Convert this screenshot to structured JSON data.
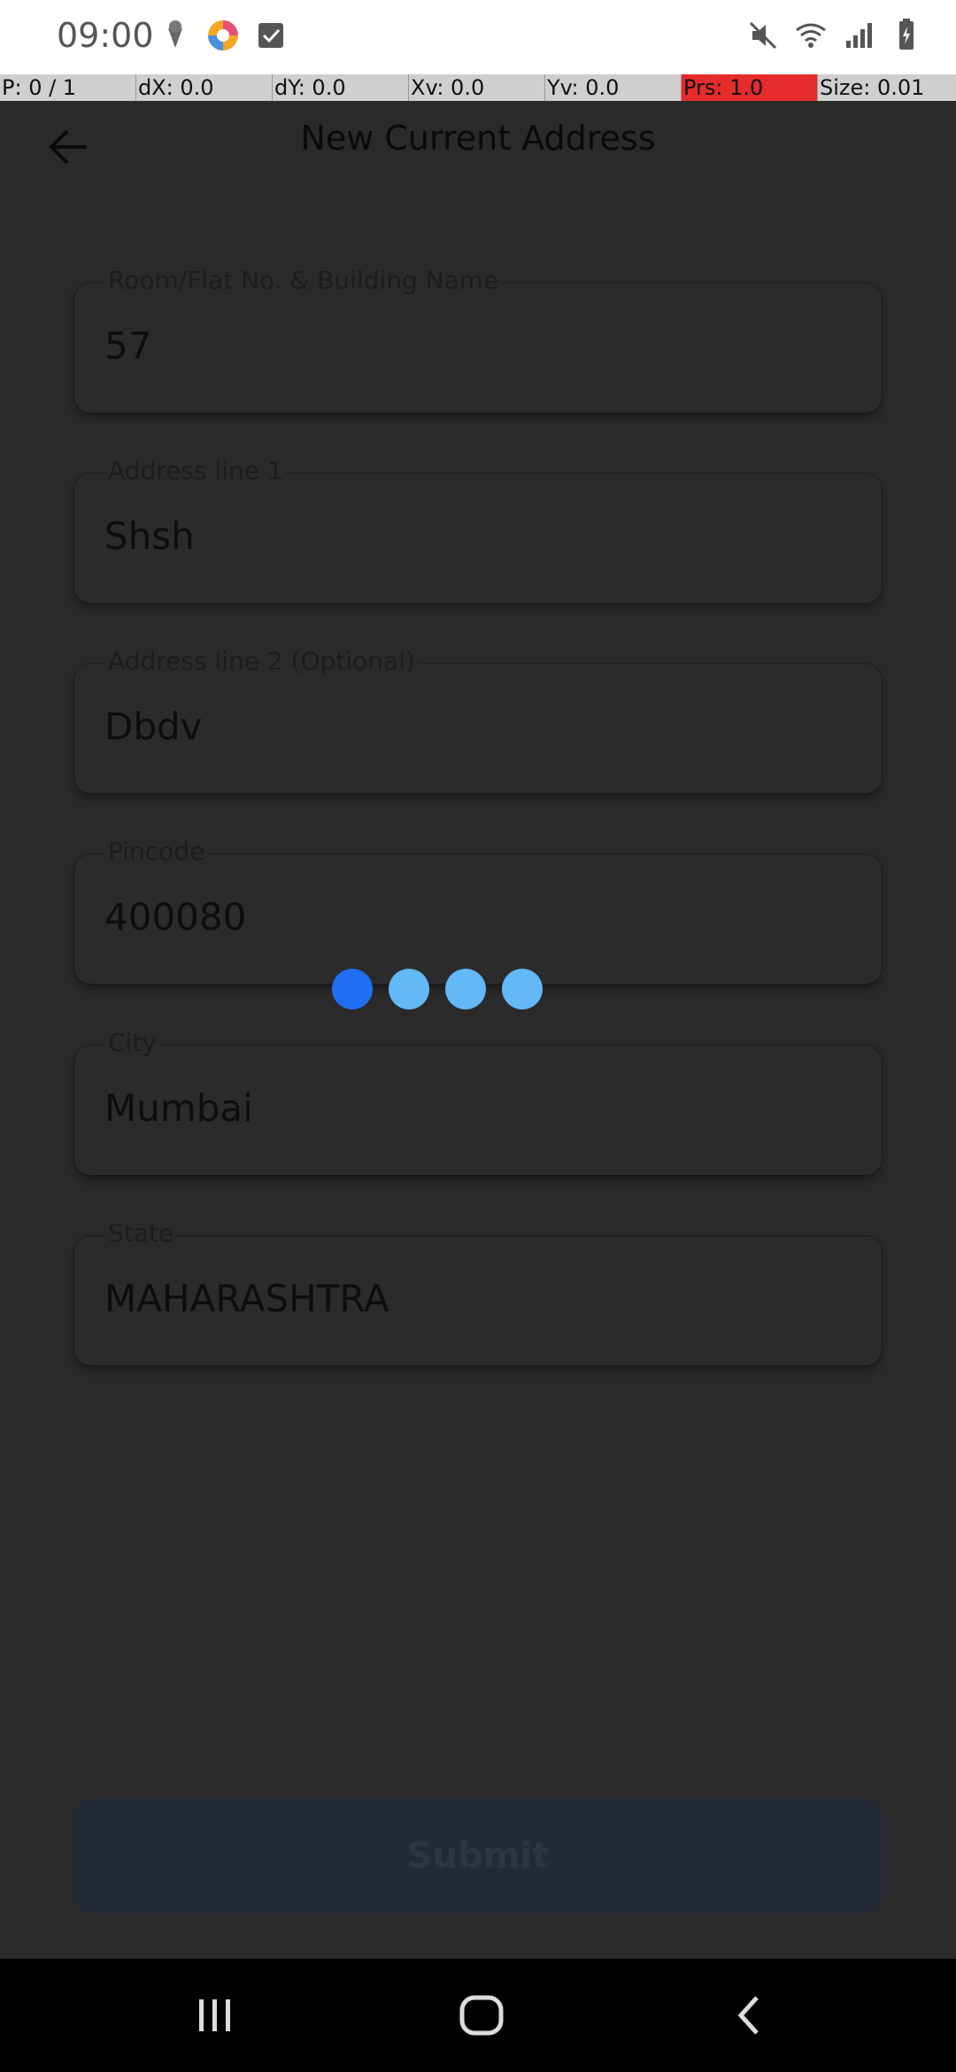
{
  "status_bar": {
    "time": "09:00",
    "left_icons": [
      "ice-cream-icon",
      "app-colorful-icon",
      "checkbox-icon"
    ],
    "right_icons": [
      "mute-icon",
      "wifi-icon",
      "signal-icon",
      "battery-icon"
    ]
  },
  "debug_bar": {
    "p": "P: 0 / 1",
    "dx": "dX: 0.0",
    "dy": "dY: 0.0",
    "xv": "Xv: 0.0",
    "yv": "Yv: 0.0",
    "prs": "Prs: 1.0",
    "size": "Size: 0.01"
  },
  "header": {
    "title": "New Current Address",
    "back_icon": "arrow-left-icon"
  },
  "form": {
    "fields": [
      {
        "label": "Room/Flat No. & Building Name",
        "value": "57"
      },
      {
        "label": "Address line 1",
        "value": "Shsh"
      },
      {
        "label": "Address line 2 (Optional)",
        "value": "Dbdv"
      },
      {
        "label": "Pincode",
        "value": "400080"
      },
      {
        "label": "City",
        "value": "Mumbai"
      },
      {
        "label": "State",
        "value": "MAHARASHTRA"
      }
    ],
    "submit_label": "Submit"
  },
  "loader": {
    "dots": 4,
    "active_index": 0
  },
  "colors": {
    "overlay": "#2a2a2a",
    "loader_active": "#1f6ef2",
    "loader_inactive": "#63b8f7",
    "debug_prs": "#e52b2b"
  },
  "nav_bar": {
    "icons": [
      "recent-apps-icon",
      "home-icon",
      "back-nav-icon"
    ]
  }
}
